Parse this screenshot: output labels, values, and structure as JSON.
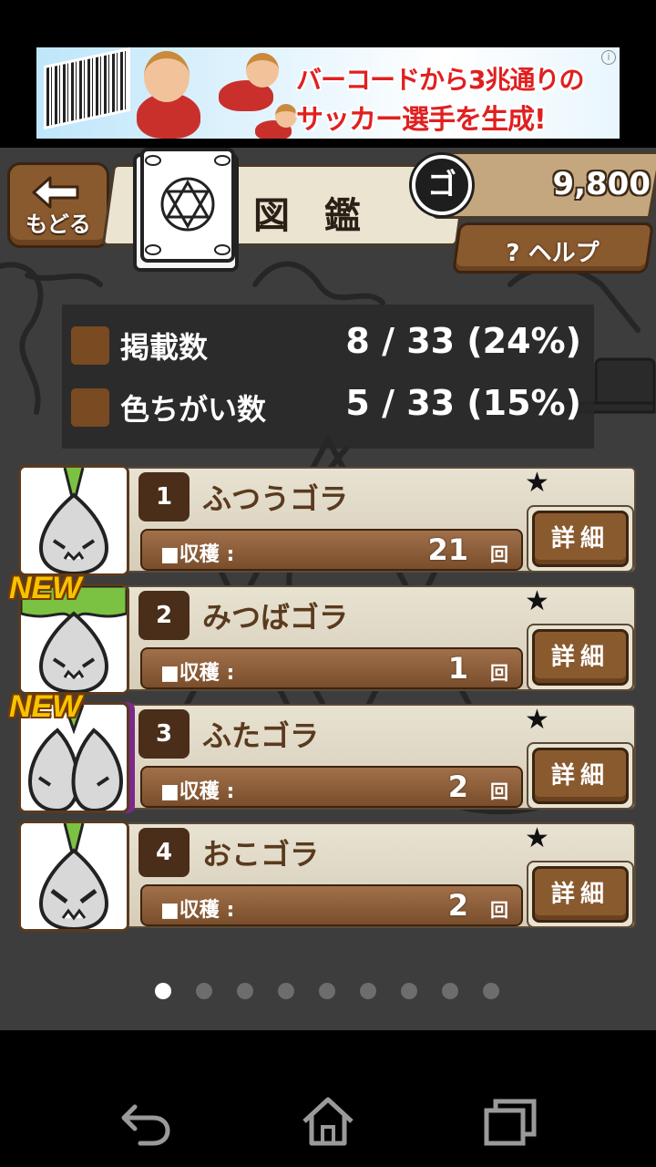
{
  "ad": {
    "line1": "バーコードから3兆通りの",
    "line2": "サッカー選手を生成!",
    "info_icon": "info-icon"
  },
  "header": {
    "back_label": "もどる",
    "title": "図 鑑",
    "currency_symbol": "ゴ",
    "currency_value": "9,800",
    "help_label": "? ヘルプ"
  },
  "stats": [
    {
      "label": "掲載数",
      "value": "8 / 33 (24%)"
    },
    {
      "label": "色ちがい数",
      "value": "5 / 33 (15%)"
    }
  ],
  "entries": [
    {
      "num": "1",
      "name": "ふつうゴラ",
      "harvest_label": "■収穫 :",
      "count": "21",
      "unit": "回",
      "detail": "詳細",
      "new": false
    },
    {
      "num": "2",
      "name": "みつばゴラ",
      "harvest_label": "■収穫 :",
      "count": "1",
      "unit": "回",
      "detail": "詳細",
      "new": true
    },
    {
      "num": "3",
      "name": "ふたゴラ",
      "harvest_label": "■収穫 :",
      "count": "2",
      "unit": "回",
      "detail": "詳細",
      "new": true
    },
    {
      "num": "4",
      "name": "おこゴラ",
      "harvest_label": "■収穫 :",
      "count": "2",
      "unit": "回",
      "detail": "詳細",
      "new": false
    }
  ],
  "new_badge": "NEW",
  "star": "★",
  "pagination": {
    "total": 9,
    "active": 1
  },
  "colors": {
    "brown": "#8a5a2f",
    "dark_brown": "#3c2410",
    "bg": "#3d3d3d",
    "card": "#e8e2d2"
  }
}
